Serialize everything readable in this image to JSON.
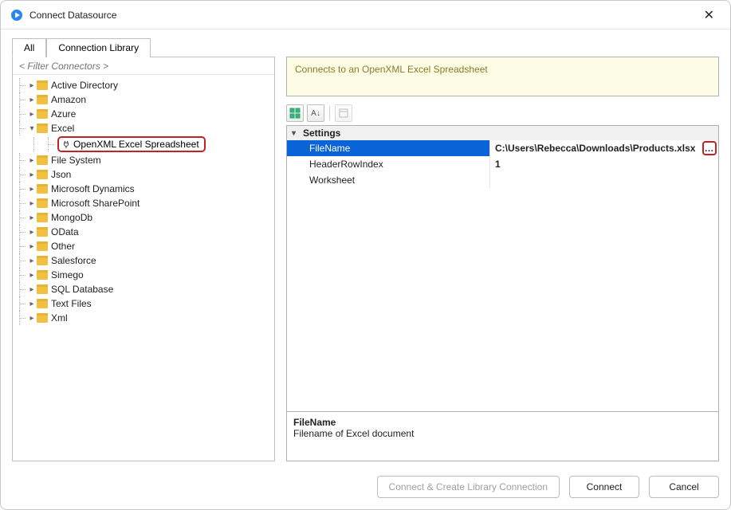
{
  "window": {
    "title": "Connect Datasource"
  },
  "tabs": {
    "all": "All",
    "library": "Connection Library"
  },
  "filter_placeholder": "< Filter Connectors >",
  "tree": {
    "items": [
      {
        "label": "Active Directory"
      },
      {
        "label": "Amazon"
      },
      {
        "label": "Azure"
      },
      {
        "label": "Excel",
        "expanded": true,
        "child": "OpenXML Excel Spreadsheet"
      },
      {
        "label": "File System"
      },
      {
        "label": "Json"
      },
      {
        "label": "Microsoft Dynamics"
      },
      {
        "label": "Microsoft SharePoint"
      },
      {
        "label": "MongoDb"
      },
      {
        "label": "OData"
      },
      {
        "label": "Other"
      },
      {
        "label": "Salesforce"
      },
      {
        "label": "Simego"
      },
      {
        "label": "SQL Database"
      },
      {
        "label": "Text Files"
      },
      {
        "label": "Xml"
      }
    ]
  },
  "description_banner": "Connects to an OpenXML Excel Spreadsheet",
  "toolbar": {
    "categorized_title": "Categorized",
    "az_title": "Alphabetical",
    "pages_title": "Property Pages"
  },
  "property_grid": {
    "category": "Settings",
    "rows": [
      {
        "name": "FileName",
        "value": "C:\\Users\\Rebecca\\Downloads\\Products.xlsx",
        "selected": true,
        "browse": true
      },
      {
        "name": "HeaderRowIndex",
        "value": "1"
      },
      {
        "name": "Worksheet",
        "value": ""
      }
    ],
    "desc_name": "FileName",
    "desc_text": "Filename of Excel document"
  },
  "buttons": {
    "create_lib": "Connect & Create Library Connection",
    "connect": "Connect",
    "cancel": "Cancel"
  }
}
